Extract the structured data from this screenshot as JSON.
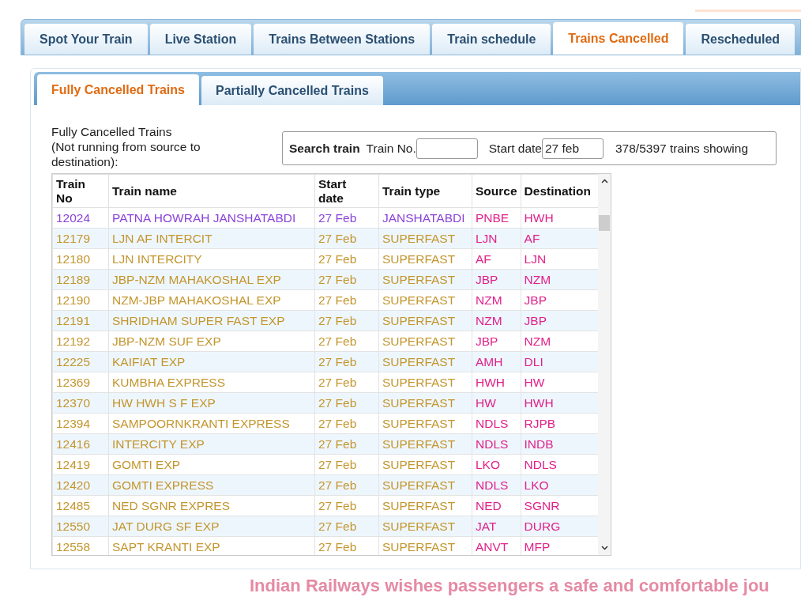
{
  "main_tabs": [
    {
      "label": "Spot Your Train",
      "selected": false
    },
    {
      "label": "Live Station",
      "selected": false
    },
    {
      "label": "Trains Between Stations",
      "selected": false
    },
    {
      "label": "Train schedule",
      "selected": false
    },
    {
      "label": "Trains Cancelled",
      "selected": true
    },
    {
      "label": "Rescheduled",
      "selected": false
    }
  ],
  "sub_tabs": [
    {
      "label": "Fully Cancelled Trains",
      "selected": true
    },
    {
      "label": "Partially Cancelled Trains",
      "selected": false
    }
  ],
  "heading": [
    "Fully Cancelled Trains",
    "(Not running from source to",
    "destination):"
  ],
  "search": {
    "title": "Search train",
    "train_no_label": "Train No.",
    "start_date_label": "Start date",
    "start_date_value": "27 feb",
    "count": "378/5397 trains showing"
  },
  "table": {
    "columns": [
      "Train No",
      "Train name",
      "Start date",
      "Train type",
      "Source",
      "Destination"
    ],
    "rows": [
      {
        "cells": [
          "12024",
          "PATNA HOWRAH JANSHATABDI",
          "27 Feb",
          "JANSHATABDI",
          "PNBE",
          "HWH"
        ],
        "color": "#8b44d8"
      },
      {
        "cells": [
          "12179",
          "LJN AF INTERCIT",
          "27 Feb",
          "SUPERFAST",
          "LJN",
          "AF"
        ],
        "color": "#c3962e"
      },
      {
        "cells": [
          "12180",
          "LJN INTERCITY",
          "27 Feb",
          "SUPERFAST",
          "AF",
          "LJN"
        ],
        "color": "#c3962e"
      },
      {
        "cells": [
          "12189",
          "JBP-NZM MAHAKOSHAL EXP",
          "27 Feb",
          "SUPERFAST",
          "JBP",
          "NZM"
        ],
        "color": "#c3962e"
      },
      {
        "cells": [
          "12190",
          "NZM-JBP MAHAKOSHAL EXP",
          "27 Feb",
          "SUPERFAST",
          "NZM",
          "JBP"
        ],
        "color": "#c3962e"
      },
      {
        "cells": [
          "12191",
          "SHRIDHAM SUPER FAST EXP",
          "27 Feb",
          "SUPERFAST",
          "NZM",
          "JBP"
        ],
        "color": "#c3962e"
      },
      {
        "cells": [
          "12192",
          "JBP-NZM SUF EXP",
          "27 Feb",
          "SUPERFAST",
          "JBP",
          "NZM"
        ],
        "color": "#c3962e"
      },
      {
        "cells": [
          "12225",
          "KAIFIAT EXP",
          "27 Feb",
          "SUPERFAST",
          "AMH",
          "DLI"
        ],
        "color": "#c3962e"
      },
      {
        "cells": [
          "12369",
          "KUMBHA EXPRESS",
          "27 Feb",
          "SUPERFAST",
          "HWH",
          "HW"
        ],
        "color": "#c3962e"
      },
      {
        "cells": [
          "12370",
          "HW HWH S F EXP",
          "27 Feb",
          "SUPERFAST",
          "HW",
          "HWH"
        ],
        "color": "#c3962e"
      },
      {
        "cells": [
          "12394",
          "SAMPOORNKRANTI EXPRESS",
          "27 Feb",
          "SUPERFAST",
          "NDLS",
          "RJPB"
        ],
        "color": "#c3962e"
      },
      {
        "cells": [
          "12416",
          "INTERCITY EXP",
          "27 Feb",
          "SUPERFAST",
          "NDLS",
          "INDB"
        ],
        "color": "#c3962e"
      },
      {
        "cells": [
          "12419",
          "GOMTI EXP",
          "27 Feb",
          "SUPERFAST",
          "LKO",
          "NDLS"
        ],
        "color": "#c3962e"
      },
      {
        "cells": [
          "12420",
          "GOMTI EXPRESS",
          "27 Feb",
          "SUPERFAST",
          "NDLS",
          "LKO"
        ],
        "color": "#c3962e"
      },
      {
        "cells": [
          "12485",
          "NED SGNR EXPRES",
          "27 Feb",
          "SUPERFAST",
          "NED",
          "SGNR"
        ],
        "color": "#c3962e"
      },
      {
        "cells": [
          "12550",
          "JAT DURG SF EXP",
          "27 Feb",
          "SUPERFAST",
          "JAT",
          "DURG"
        ],
        "color": "#c3962e"
      },
      {
        "cells": [
          "12558",
          "SAPT KRANTI EXP",
          "27 Feb",
          "SUPERFAST",
          "ANVT",
          "MFP"
        ],
        "color": "#c3962e"
      }
    ]
  },
  "footer": "Indian Railways wishes passengers a safe and comfortable jou"
}
